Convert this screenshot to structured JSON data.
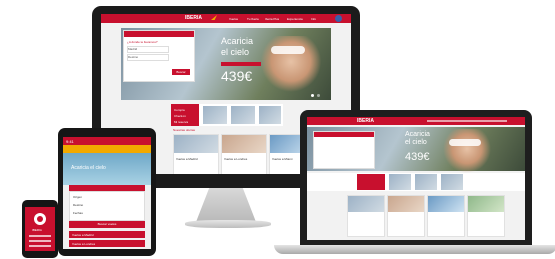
{
  "brand": {
    "name": "IBERIA",
    "accent": "#c8102e",
    "accent_orange": "#f2a900"
  },
  "monitor": {
    "nav": [
      "Vuelos",
      "Tu Iberia",
      "Iberia Plus",
      "Experiencia",
      "Info"
    ],
    "search_title": "¿A dónde te llevamos?",
    "search_field_origin": "Madrid",
    "search_field_dest": "Destino",
    "search_button": "Buscar",
    "hero_headline_1": "Acaricia",
    "hero_headline_2": "el cielo",
    "hero_price": "439€",
    "offers_heading": "Nuestras ofertas",
    "offers": [
      "Vuelos a Madrid",
      "Vuelos a Londres",
      "Vuelos a Miami"
    ],
    "promo_items": [
      "Compra",
      "Check-in",
      "Mi reserva"
    ]
  },
  "laptop": {
    "hero_headline_1": "Acaricia",
    "hero_headline_2": "el cielo",
    "hero_price": "439€"
  },
  "tablet": {
    "time": "9:41",
    "banner_text": "Acaricia el cielo",
    "offers": [
      "Vuelos a Madrid",
      "Vuelos a Londres"
    ],
    "form_labels": [
      "Origen",
      "Destino",
      "Fechas"
    ],
    "cta": "Buscar vuelos"
  },
  "phone": {
    "label": "IBERIA"
  }
}
